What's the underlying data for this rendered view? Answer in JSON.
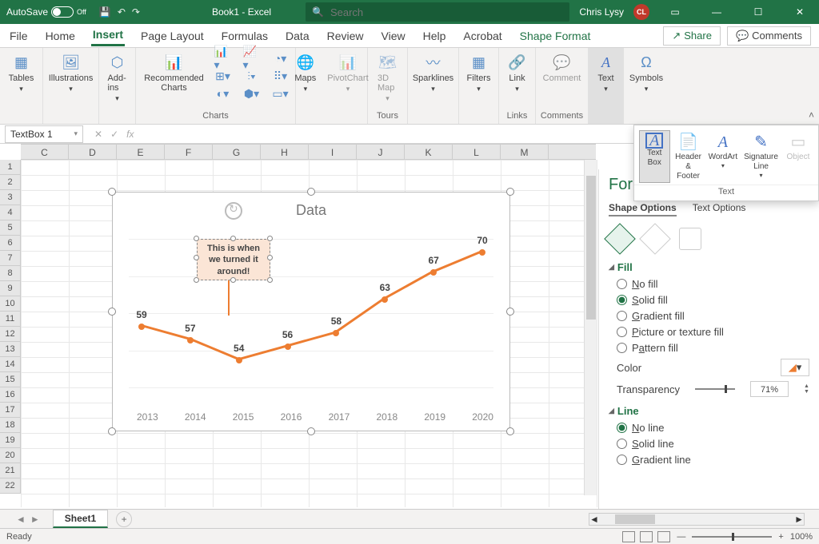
{
  "title_bar": {
    "autosave_label": "AutoSave",
    "autosave_state": "Off",
    "doc_title": "Book1 - Excel",
    "search_placeholder": "Search",
    "user_name": "Chris Lysy",
    "user_initials": "CL"
  },
  "menu": {
    "tabs": [
      "File",
      "Home",
      "Insert",
      "Page Layout",
      "Formulas",
      "Data",
      "Review",
      "View",
      "Help",
      "Acrobat",
      "Shape Format"
    ],
    "active": "Insert",
    "share": "Share",
    "comments": "Comments"
  },
  "ribbon": {
    "tables": "Tables",
    "illustrations": "Illustrations",
    "addins": "Add-ins",
    "rec_charts": "Recommended Charts",
    "charts": "Charts",
    "maps": "Maps",
    "pivotchart": "PivotChart",
    "tours": "Tours",
    "tours_btn": "3D Map",
    "sparklines": "Sparklines",
    "filters": "Filters",
    "links": "Links",
    "link": "Link",
    "comments": "Comments",
    "comment": "Comment",
    "text": "Text",
    "symbols": "Symbols"
  },
  "text_panel": {
    "items": [
      "Text Box",
      "Header & Footer",
      "WordArt",
      "Signature Line",
      "Object"
    ],
    "group_label": "Text"
  },
  "formula_bar": {
    "name_box": "TextBox 1"
  },
  "grid": {
    "columns": [
      "C",
      "D",
      "E",
      "F",
      "G",
      "H",
      "I",
      "J",
      "K",
      "L",
      "M"
    ],
    "rows": [
      "1",
      "2",
      "3",
      "4",
      "5",
      "6",
      "7",
      "8",
      "9",
      "10",
      "11",
      "12",
      "13",
      "14",
      "15",
      "16",
      "17",
      "18",
      "19",
      "20",
      "21",
      "22"
    ]
  },
  "chart_data": {
    "type": "line",
    "title": "Data",
    "categories": [
      "2013",
      "2014",
      "2015",
      "2016",
      "2017",
      "2018",
      "2019",
      "2020"
    ],
    "values": [
      59,
      57,
      54,
      56,
      58,
      63,
      67,
      70
    ],
    "annotation": "This is when we turned it around!",
    "ylim": [
      50,
      72
    ],
    "color": "#ed7d31"
  },
  "format_pane": {
    "title": "Form",
    "tab1": "Shape Options",
    "tab2": "Text Options",
    "fill_head": "Fill",
    "fill_opts": {
      "none": "No fill",
      "solid": "Solid fill",
      "grad": "Gradient fill",
      "pict": "Picture or texture fill",
      "patt": "Pattern fill"
    },
    "fill_selected": "solid",
    "color_label": "Color",
    "transp_label": "Transparency",
    "transp_value": "71%",
    "line_head": "Line",
    "line_opts": {
      "none": "No line",
      "solid": "Solid line",
      "grad": "Gradient line"
    },
    "line_selected": "none"
  },
  "sheets": {
    "tabs": [
      "Sheet1"
    ]
  },
  "status": {
    "ready": "Ready",
    "zoom": "100%"
  }
}
